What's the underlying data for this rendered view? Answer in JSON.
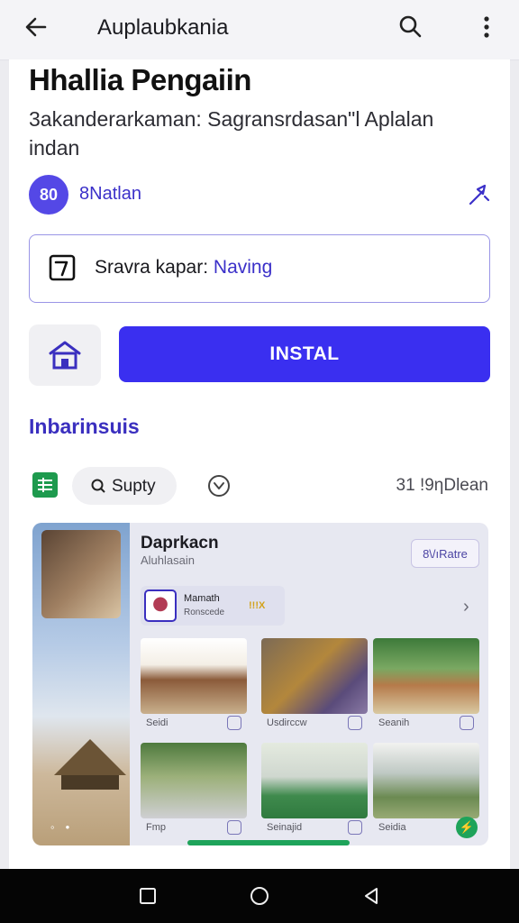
{
  "topbar": {
    "title": "Auplaubkania",
    "back_icon": "arrow-left-icon",
    "search_icon": "search-icon",
    "more_icon": "more-vertical-icon"
  },
  "app": {
    "name": "Hhallia Pengaiin",
    "subtitle": "3akanderarkaman: Sagransrdasan\"l Aplalan indan"
  },
  "developer": {
    "avatar_text": "80",
    "name": "8Natlan",
    "share_icon": "share-icon"
  },
  "info_box": {
    "label": "Sravra kapar:",
    "value": "Naving",
    "icon": "calendar-icon"
  },
  "actions": {
    "home_icon": "home-icon",
    "install_label": "INSTAL"
  },
  "section": {
    "title": "Inbarinsuis"
  },
  "filter_row": {
    "chip_label": "Supty",
    "count": "31 !9ηDlean"
  },
  "preview": {
    "header": "Daprkacn",
    "subheader": "Aluhlasain",
    "button_label": "8\\/ıRatre",
    "card_title": "Mamath",
    "card_subtitle": "Ronscede",
    "card_badge": "!!!X",
    "tiles": [
      {
        "caption": "Seidi"
      },
      {
        "caption": "Usdirccw"
      },
      {
        "caption": "Seanih"
      },
      {
        "caption": "Fmp"
      },
      {
        "caption": "Seinajid"
      },
      {
        "caption": "Seidia"
      }
    ]
  },
  "colors": {
    "accent": "#3a2ff0",
    "accent_text": "#3b30c9",
    "green": "#1ea35a"
  }
}
